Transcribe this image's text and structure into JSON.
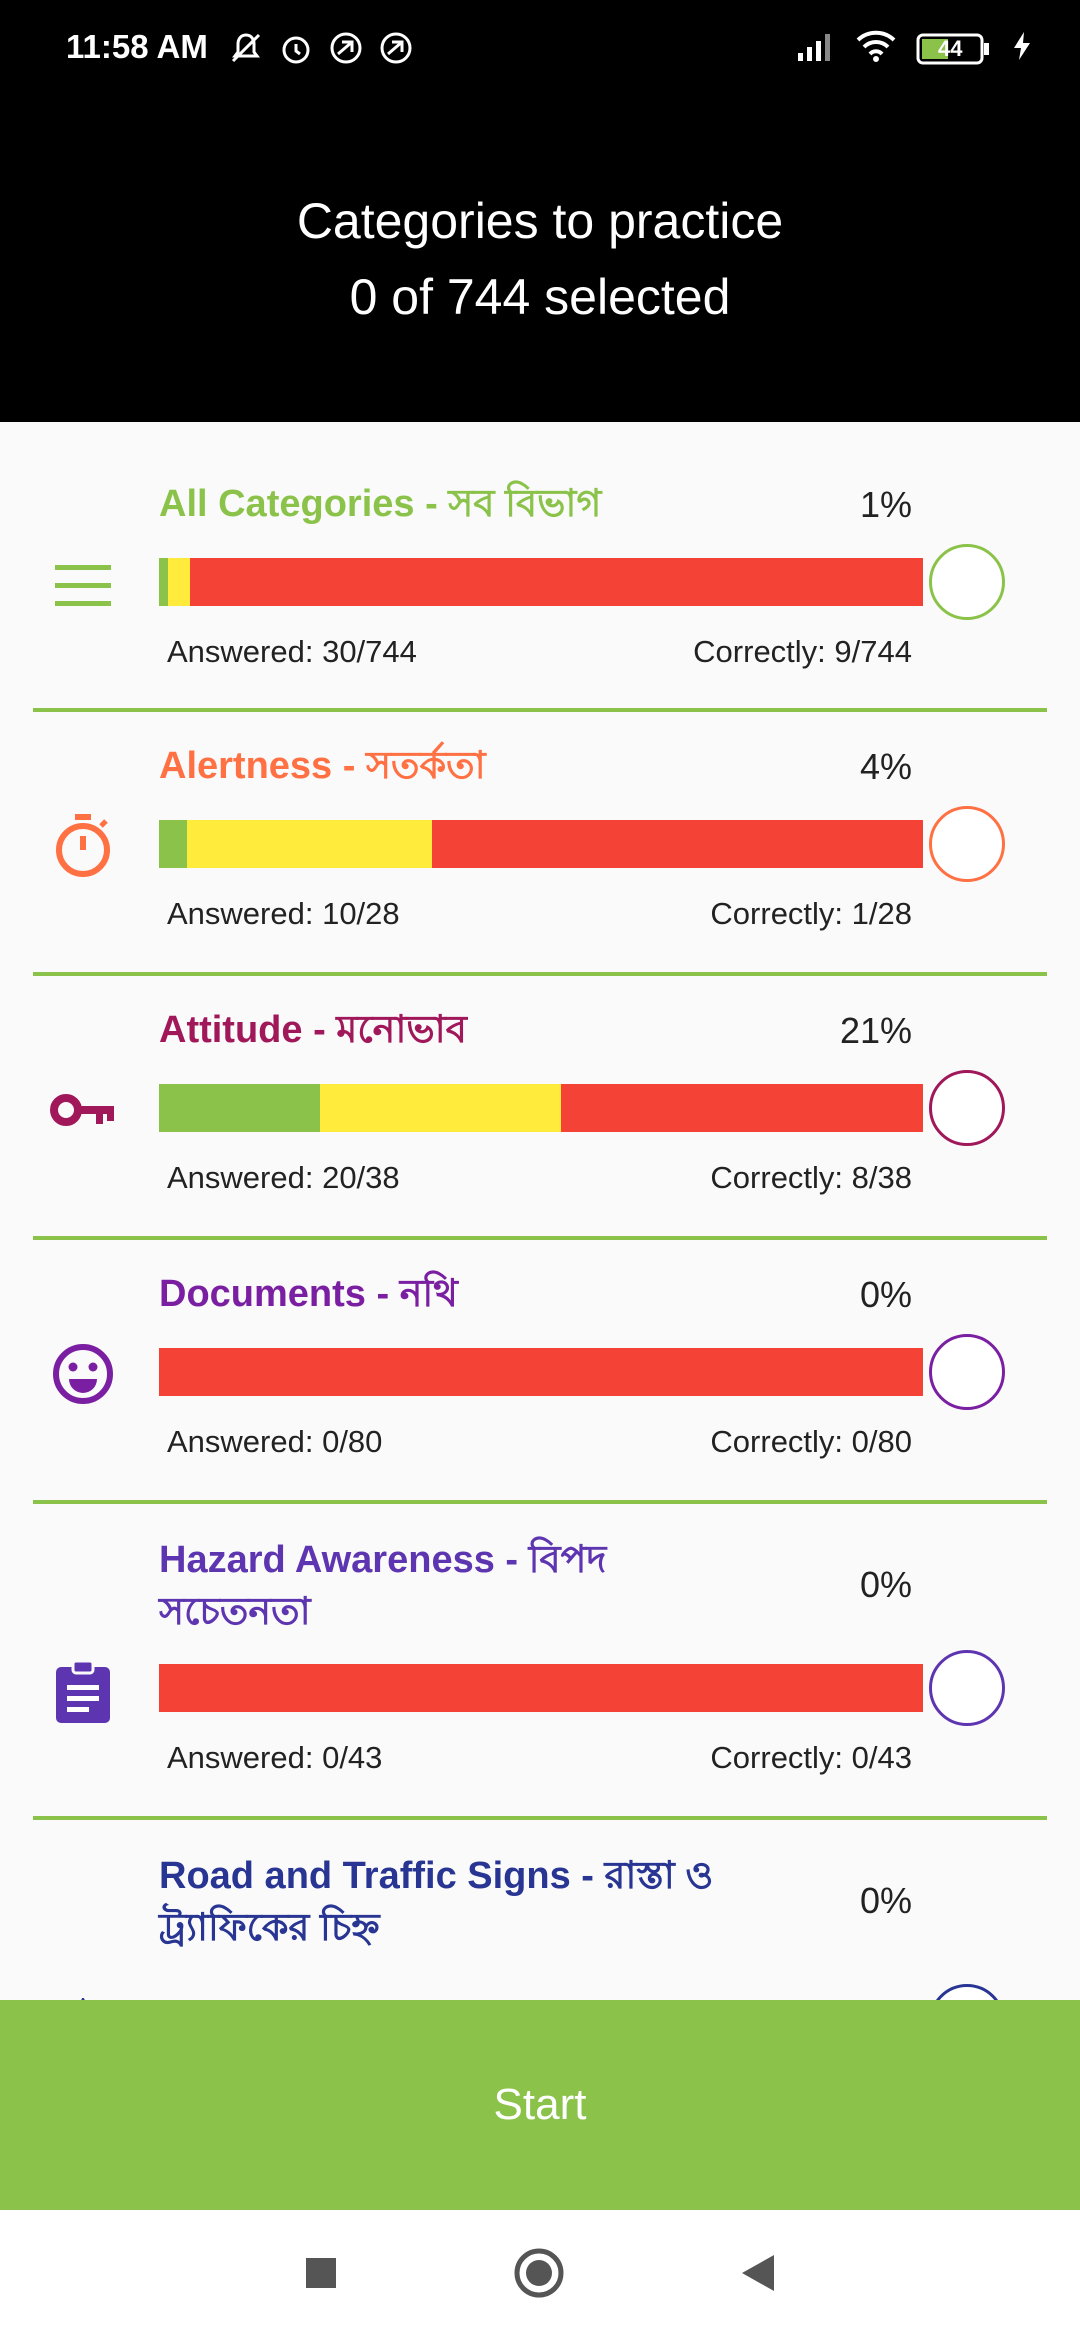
{
  "status": {
    "time": "11:58 AM",
    "battery": "44"
  },
  "header": {
    "title": "Categories to practice",
    "subtitle": "0 of 744 selected"
  },
  "colors": {
    "accent": "#8bc34a",
    "correct": "#8bc34a",
    "answered": "#ffeb3b",
    "unanswered": "#f44336"
  },
  "categories": [
    {
      "name": "All Categories - সব বিভাগ",
      "percent": "1%",
      "answered": "Answered: 30/744",
      "correct": "Correctly: 9/744",
      "color": "#8bc34a",
      "icon": "list-icon",
      "progress": {
        "correct_frac": 0.012,
        "answered_frac": 0.04
      }
    },
    {
      "name": "Alertness - সতর্কতা",
      "percent": "4%",
      "answered": "Answered: 10/28",
      "correct": "Correctly: 1/28",
      "color": "#ff7043",
      "icon": "stopwatch-icon",
      "progress": {
        "correct_frac": 0.036,
        "answered_frac": 0.357
      }
    },
    {
      "name": "Attitude - মনোভাব",
      "percent": "21%",
      "answered": "Answered: 20/38",
      "correct": "Correctly: 8/38",
      "color": "#a0185a",
      "icon": "key-icon",
      "progress": {
        "correct_frac": 0.211,
        "answered_frac": 0.526
      }
    },
    {
      "name": "Documents - নথি",
      "percent": "0%",
      "answered": "Answered: 0/80",
      "correct": "Correctly: 0/80",
      "color": "#7b1fa2",
      "icon": "smiley-icon",
      "progress": {
        "correct_frac": 0,
        "answered_frac": 0
      }
    },
    {
      "name": "Hazard Awareness - বিপদ সচেতনতা",
      "percent": "0%",
      "answered": "Answered: 0/43",
      "correct": "Correctly: 0/43",
      "color": "#5e35b1",
      "icon": "clipboard-icon",
      "progress": {
        "correct_frac": 0,
        "answered_frac": 0
      }
    },
    {
      "name": "Road and Traffic Signs - রাস্তা ও ট্র্যাফিকের চিহ্ন",
      "percent": "0%",
      "answered": "",
      "correct": "",
      "color": "#283593",
      "icon": "sign-icon",
      "progress": {
        "correct_frac": 0,
        "answered_frac": 0
      }
    }
  ],
  "start_button": "Start"
}
